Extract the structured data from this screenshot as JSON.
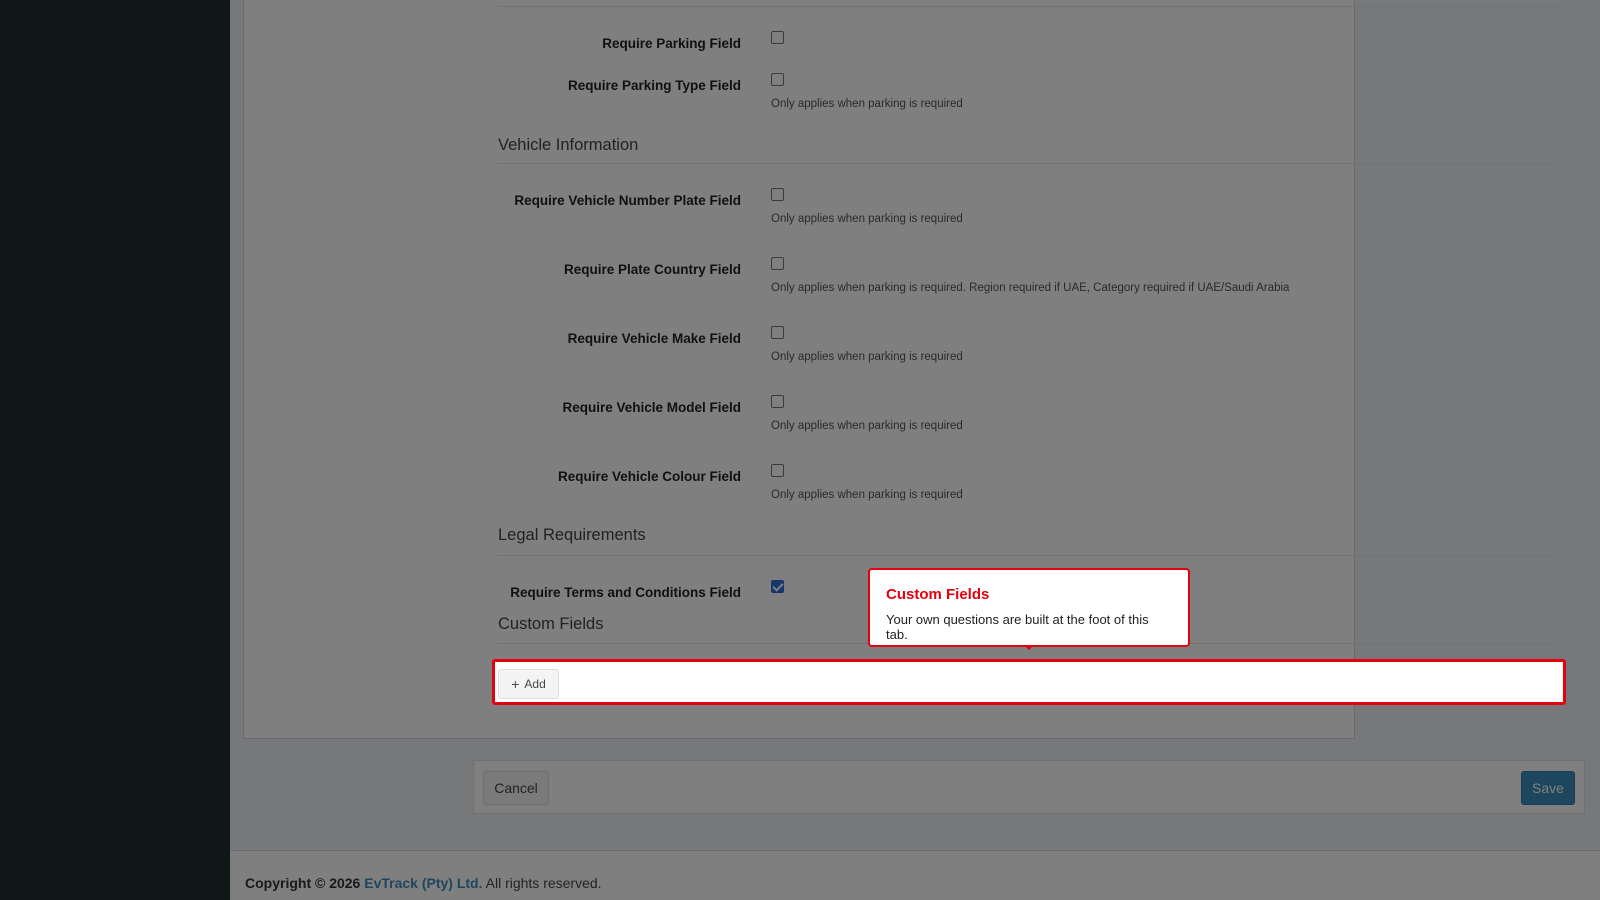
{
  "form": {
    "parking": {
      "require_parking_label": "Require Parking Field",
      "require_parking_type_label": "Require Parking Type Field",
      "require_parking_type_help": "Only applies when parking is required",
      "require_parking_checked": false,
      "require_parking_type_checked": false
    },
    "vehicle": {
      "title": "Vehicle Information",
      "fields": [
        {
          "label": "Require Vehicle Number Plate Field",
          "help": "Only applies when parking is required",
          "checked": false
        },
        {
          "label": "Require Plate Country Field",
          "help": "Only applies when parking is required. Region required if UAE, Category required if UAE/Saudi Arabia",
          "checked": false
        },
        {
          "label": "Require Vehicle Make Field",
          "help": "Only applies when parking is required",
          "checked": false
        },
        {
          "label": "Require Vehicle Model Field",
          "help": "Only applies when parking is required",
          "checked": false
        },
        {
          "label": "Require Vehicle Colour Field",
          "help": "Only applies when parking is required",
          "checked": false
        }
      ]
    },
    "legal": {
      "title": "Legal Requirements",
      "terms_label": "Require Terms and Conditions Field",
      "terms_checked": true
    },
    "custom": {
      "title": "Custom Fields",
      "add_icon": "plus-icon",
      "add_label": "Add"
    }
  },
  "actions": {
    "cancel_label": "Cancel",
    "save_label": "Save",
    "save_color": "#3c8dbc"
  },
  "footer": {
    "copyright_prefix": "Copyright © 2026",
    "company": "EvTrack (Pty) Ltd.",
    "suffix": "All rights reserved."
  },
  "tour": {
    "title": "Custom Fields",
    "body": "Your own questions are built at the foot of this tab.",
    "accent_color": "#e3000f"
  }
}
